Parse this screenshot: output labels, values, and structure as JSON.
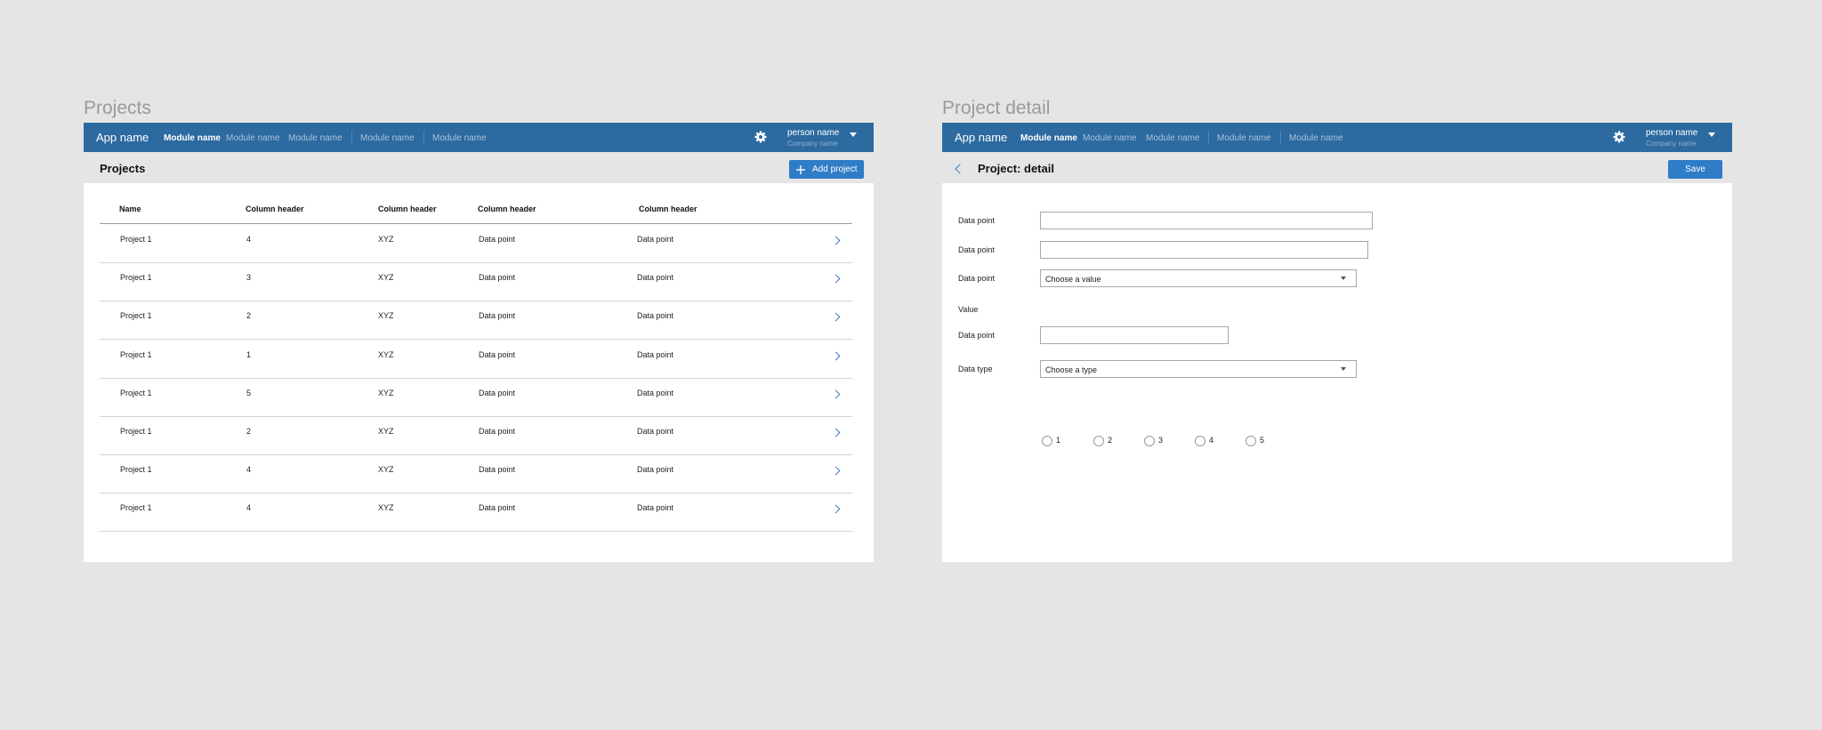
{
  "colors": {
    "nav": "#2c6aa0",
    "accent": "#2f7cc7",
    "background": "#e5e5e5"
  },
  "projects_screen": {
    "frame_title": "Projects",
    "nav": {
      "app_name": "App name",
      "modules": [
        "Module name",
        "Module name",
        "Module name",
        "Module name",
        "Module name"
      ],
      "person_name": "person name",
      "company_name": "Company name",
      "settings_icon": "gear-icon"
    },
    "page_title": "Projects",
    "add_button_label": "Add project",
    "add_icon": "plus-icon",
    "table": {
      "headers": [
        "Name",
        "Column header",
        "Column header",
        "Column header",
        "Column header"
      ],
      "rows": [
        [
          "Project 1",
          "4",
          "XYZ",
          "Data point",
          "Data point"
        ],
        [
          "Project 1",
          "3",
          "XYZ",
          "Data point",
          "Data point"
        ],
        [
          "Project 1",
          "2",
          "XYZ",
          "Data point",
          "Data point"
        ],
        [
          "Project 1",
          "1",
          "XYZ",
          "Data point",
          "Data point"
        ],
        [
          "Project 1",
          "5",
          "XYZ",
          "Data point",
          "Data point"
        ],
        [
          "Project 1",
          "2",
          "XYZ",
          "Data point",
          "Data point"
        ],
        [
          "Project 1",
          "4",
          "XYZ",
          "Data point",
          "Data point"
        ],
        [
          "Project 1",
          "4",
          "XYZ",
          "Data point",
          "Data point"
        ]
      ]
    }
  },
  "detail_screen": {
    "frame_title": "Project detail",
    "nav": {
      "app_name": "App name",
      "modules": [
        "Module name",
        "Module name",
        "Module name",
        "Module name",
        "Module name"
      ],
      "person_name": "person name",
      "company_name": "Company name",
      "settings_icon": "gear-icon"
    },
    "page_title": "Project: detail",
    "save_button_label": "Save",
    "back_icon": "chevron-left-icon",
    "form": {
      "field1_label": "Data point",
      "field1_value": "",
      "field2_label": "Data point",
      "field2_value": "",
      "select1_label": "Data point",
      "select1_value": "Choose a value",
      "radio_label": "Value",
      "radio_options": [
        "1",
        "2",
        "3",
        "4",
        "5"
      ],
      "field3_label": "Data point",
      "field3_value": "",
      "select2_label": "Data type",
      "select2_value": "Choose a type"
    }
  }
}
